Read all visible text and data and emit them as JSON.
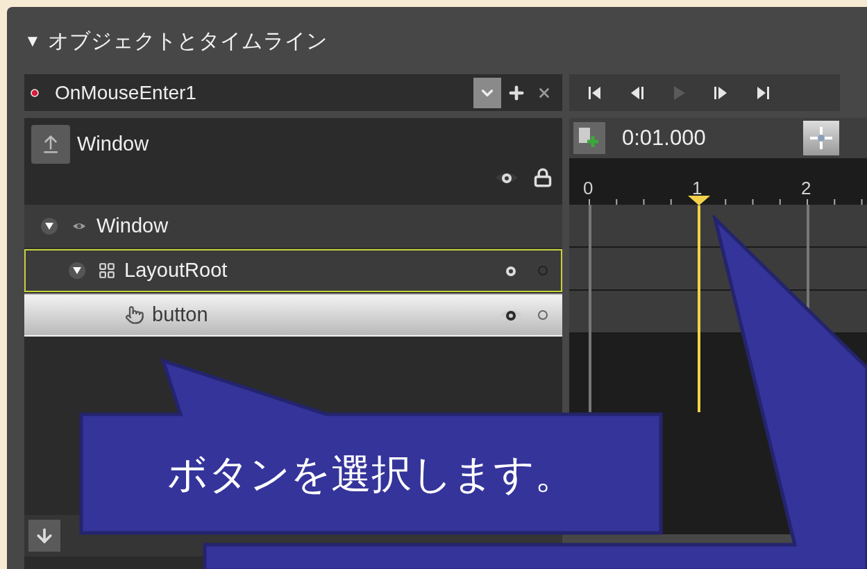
{
  "panel": {
    "collapse_glyph": "▼",
    "title": "オブジェクトとタイムライン"
  },
  "storyboard": {
    "name": "OnMouseEnter1",
    "recording": true
  },
  "transport": [
    {
      "kind": "first",
      "disabled": false
    },
    {
      "kind": "prev",
      "disabled": false
    },
    {
      "kind": "play",
      "disabled": true
    },
    {
      "kind": "next",
      "disabled": false
    },
    {
      "kind": "last",
      "disabled": false
    }
  ],
  "scope": {
    "name": "Window"
  },
  "time": "0:01.000",
  "ruler": [
    {
      "text": "0",
      "playhead": false
    },
    {
      "text": "1",
      "playhead": true
    },
    {
      "text": "2",
      "playhead": false
    }
  ],
  "tree": [
    {
      "name": "Window",
      "kind": "window",
      "expanded": true,
      "selected": false,
      "active": false,
      "children": [
        {
          "name": "LayoutRoot",
          "kind": "grid",
          "expanded": true,
          "selected": false,
          "active": true,
          "children": [
            {
              "name": "button",
              "kind": "button",
              "selected": true,
              "active": false
            }
          ]
        }
      ]
    }
  ],
  "callouts": [
    {
      "text": "ボタンを選択します。"
    }
  ]
}
